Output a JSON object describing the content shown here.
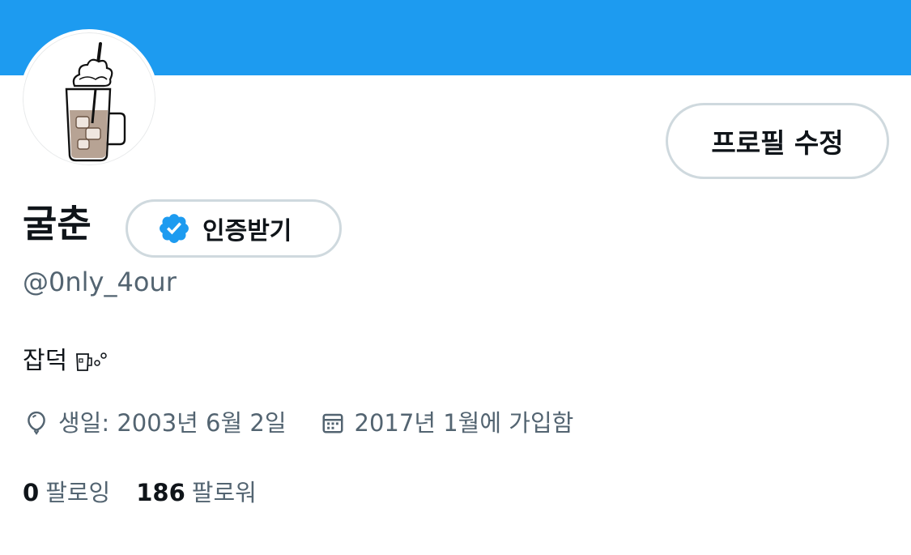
{
  "colors": {
    "banner": "#1d9bf0",
    "verified_badge": "#1d9bf0",
    "secondary_text": "#536471",
    "primary_text": "#0f1419",
    "button_border": "#cfd9de"
  },
  "profile": {
    "display_name": "굴춘",
    "handle": "@0nly_4our",
    "bio": "잡덕",
    "bio_icon": "iced-drink-emoji",
    "edit_button_label": "프로필 수정",
    "verify_button_label": "인증받기",
    "birthday": "생일: 2003년 6월 2일",
    "joined": "2017년 1월에 가입함"
  },
  "stats": {
    "following_count": "0",
    "following_label": "팔로잉",
    "followers_count": "186",
    "followers_label": "팔로워"
  },
  "icons": {
    "verified": "verified-badge-icon",
    "birthday": "balloon-icon",
    "joined": "calendar-icon"
  }
}
